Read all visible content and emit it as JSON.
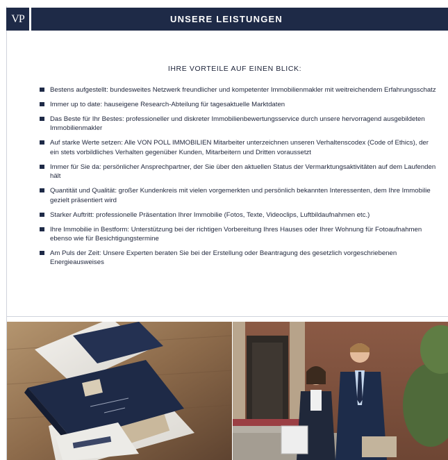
{
  "header": {
    "logo_text": "VP",
    "title": "UNSERE LEISTUNGEN"
  },
  "content": {
    "subheading": "IHRE VORTEILE AUF EINEN BLICK:",
    "bullets": [
      {
        "text": "Bestens aufgestellt: bundesweites Netzwerk freundlicher und kompetenter Immobilienmakler mit weitreichendem Erfahrungsschatz"
      },
      {
        "text": "Immer up to date: hauseigene Research-Abteilung für tagesaktuelle Marktdaten"
      },
      {
        "text": "Das Beste für Ihr Bestes: professioneller und diskreter Immobilienbewertungsservice durch unsere hervorragend ausgebildeten Immobilienmakler"
      },
      {
        "text": "Auf starke Werte setzen: Alle VON POLL IMMOBILIEN Mitarbeiter unterzeichnen unseren Verhaltenscodex (Code of Ethics), der ein stets vorbildliches Verhalten gegenüber Kunden, Mitarbeitern und Dritten voraussetzt"
      },
      {
        "text": "Immer für Sie da: persönlicher Ansprechpartner, der Sie über den aktuellen Status der Vermarktungsaktivitäten auf dem Laufenden hält"
      },
      {
        "text": "Quantität und Qualität: großer Kundenkreis mit vielen vorgemerkten und persönlich bekannten Interessenten, dem Ihre Immobilie gezielt präsentiert wird"
      },
      {
        "text": "Starker Auftritt: professionelle Präsentation Ihrer Immobilie (Fotos, Texte, Videoclips, Luftbildaufnahmen etc.)"
      },
      {
        "text": "Ihre Immobilie in Bestform: Unterstützung bei der richtigen Vorbereitung Ihres Hauses oder Ihrer Wohnung für Fotoaufnahmen ebenso wie für Besichtigungstermine"
      },
      {
        "text": "Am Puls der Zeit: Unsere Experten beraten Sie bei der Erstellung oder Beantragung des gesetzlich vorgeschriebenen Energieausweises"
      }
    ]
  },
  "photos": {
    "left_icon": "brochures-on-table-photo",
    "right_icon": "agents-walking-photo"
  },
  "colors": {
    "brand_navy": "#1e2a47",
    "text": "#22293e"
  }
}
